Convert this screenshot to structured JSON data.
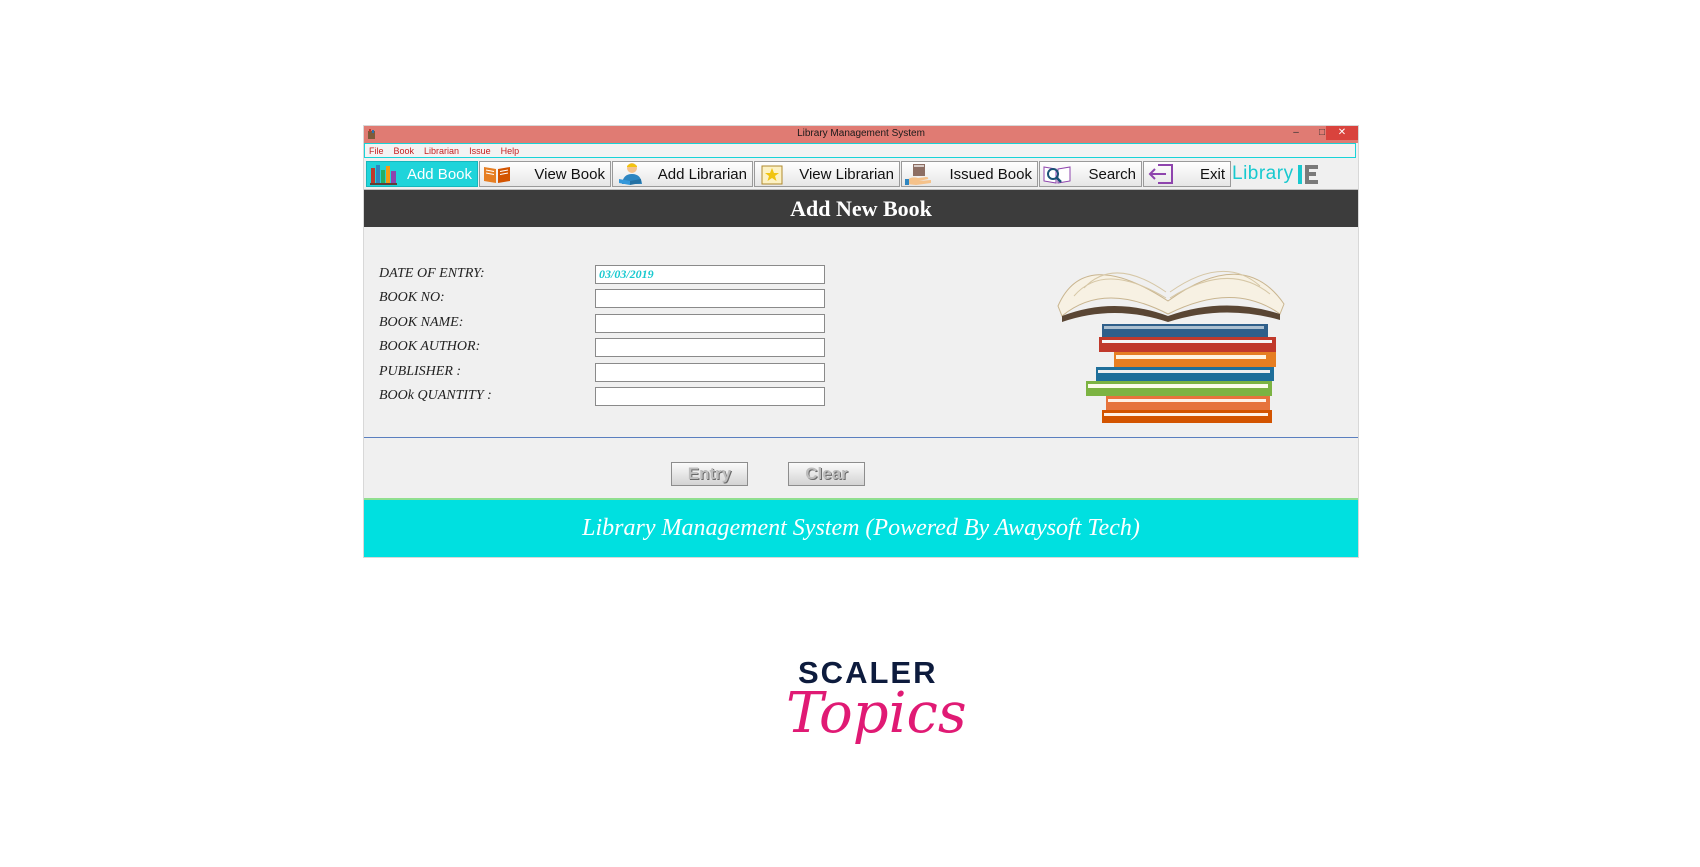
{
  "window": {
    "title": "Library Management System",
    "controls": {
      "minimize": "‒",
      "maximize": "□",
      "close": "✕"
    }
  },
  "menubar": {
    "items": [
      {
        "label": "File"
      },
      {
        "label": "Book"
      },
      {
        "label": "Librarian"
      },
      {
        "label": "Issue"
      },
      {
        "label": "Help"
      }
    ]
  },
  "toolbar": {
    "items": [
      {
        "label": "Add Book",
        "icon": "books-icon",
        "active": true
      },
      {
        "label": "View Book",
        "icon": "open-book-icon",
        "active": false
      },
      {
        "label": "Add Librarian",
        "icon": "person-reading-icon",
        "active": false
      },
      {
        "label": "View Librarian",
        "icon": "book-star-icon",
        "active": false
      },
      {
        "label": "Issued Book",
        "icon": "hand-book-icon",
        "active": false
      },
      {
        "label": "Search",
        "icon": "book-search-icon",
        "active": false
      },
      {
        "label": "Exit",
        "icon": "exit-arrow-icon",
        "active": false
      }
    ],
    "brand": "Library"
  },
  "header": {
    "title": "Add New Book"
  },
  "form": {
    "fields": [
      {
        "label": "DATE OF ENTRY:",
        "value": "03/03/2019"
      },
      {
        "label": "BOOK NO:",
        "value": ""
      },
      {
        "label": "BOOK NAME:",
        "value": ""
      },
      {
        "label": "BOOK AUTHOR:",
        "value": ""
      },
      {
        "label": "PUBLISHER :",
        "value": ""
      },
      {
        "label": "BOOk QUANTITY :",
        "value": ""
      }
    ]
  },
  "actions": {
    "entry": "Entry",
    "clear": "Clear"
  },
  "footer": {
    "text": "Library Management System (Powered By Awaysoft Tech)"
  },
  "logo": {
    "line1": "SCALER",
    "line2": "Topics"
  },
  "colors": {
    "accent": "#1fd4da",
    "titlebar": "#e07b73",
    "header": "#3c3c3c",
    "footer": "#00e0e0",
    "brand_pink": "#e01a74",
    "brand_navy": "#0d1b3d"
  }
}
